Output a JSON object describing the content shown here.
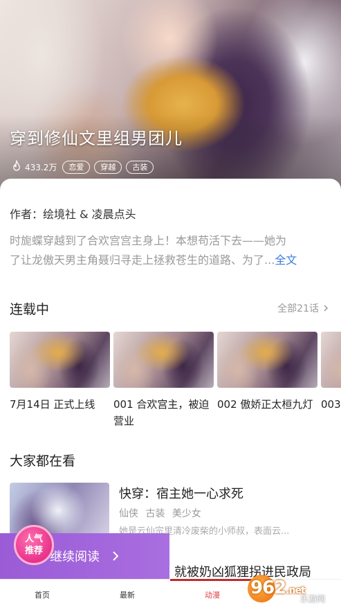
{
  "hero": {
    "title": "穿到修仙文里组男团儿",
    "popularity": "433.2万",
    "tags": [
      "恋爱",
      "穿越",
      "古装"
    ]
  },
  "info": {
    "author": "作者：绘境社 & 凌晨点头",
    "description_line1": "时旎蝶穿越到了合欢宫宫主身上！本想苟活下去——她为",
    "description_line2": "了让龙傲天男主角聂归寻走上拯救苍生的道路、为了",
    "ellipsis": "...",
    "more_label": "全文"
  },
  "serial": {
    "title": "连载中",
    "all_label": "全部21话",
    "episodes": [
      {
        "title": "7月14日 正式上线"
      },
      {
        "title": "001 合欢宫主，被迫营业"
      },
      {
        "title": "002 傲娇正太桓九灯"
      },
      {
        "title": "003"
      }
    ]
  },
  "recommend": {
    "title": "大家都在看",
    "item": {
      "title": "快穿：宿主她一心求死",
      "tags": [
        "仙侠",
        "古装",
        "美少女"
      ],
      "description": "她是云仙宗里清冷废柴的小师叔，表面云..."
    },
    "peek_title": "就被奶凶狐狸拐进民政局"
  },
  "continue": {
    "badge_line1": "人气",
    "badge_line2": "推荐",
    "label": "继续阅读"
  },
  "tabs": [
    {
      "label": "首页",
      "active": false
    },
    {
      "label": "最新",
      "active": false
    },
    {
      "label": "动漫",
      "active": true
    },
    {
      "label": "",
      "active": false
    }
  ],
  "watermark": {
    "number": "962",
    "suffix": ".net",
    "text": "乐游网"
  },
  "colors": {
    "accent_link": "#3a7be0",
    "active_tab": "#e23b3b",
    "continue_bar": "#9b5bd6",
    "badge": "#e8338b"
  }
}
